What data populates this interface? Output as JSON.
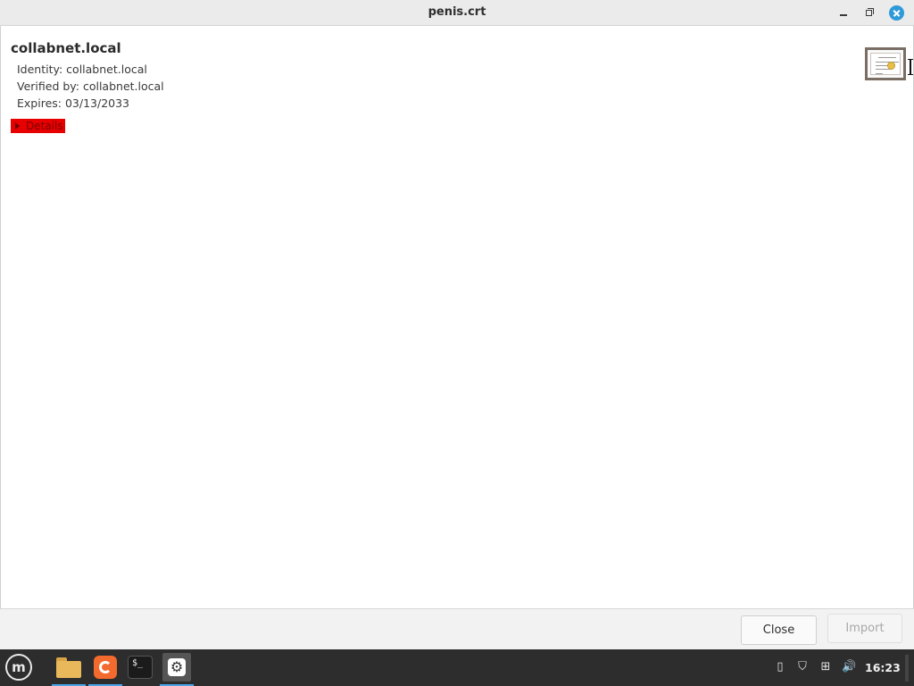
{
  "window": {
    "title": "penis.crt"
  },
  "certificate": {
    "name": "collabnet.local",
    "identity": "Identity: collabnet.local",
    "verified_by": "Verified by: collabnet.local",
    "expires": "Expires: 03/13/2033",
    "details_label": "Details"
  },
  "buttons": {
    "close_label": "Close",
    "import_label": "Import"
  },
  "taskbar": {
    "menu_icon": "mint-menu-icon",
    "apps": [
      "folder-icon",
      "firefox-icon",
      "terminal-icon",
      "settings-icon"
    ],
    "terminal_glyph": "$_",
    "clock": "16:23"
  },
  "colors": {
    "accent": "#2f9ad8",
    "details_highlight": "#e80000"
  }
}
